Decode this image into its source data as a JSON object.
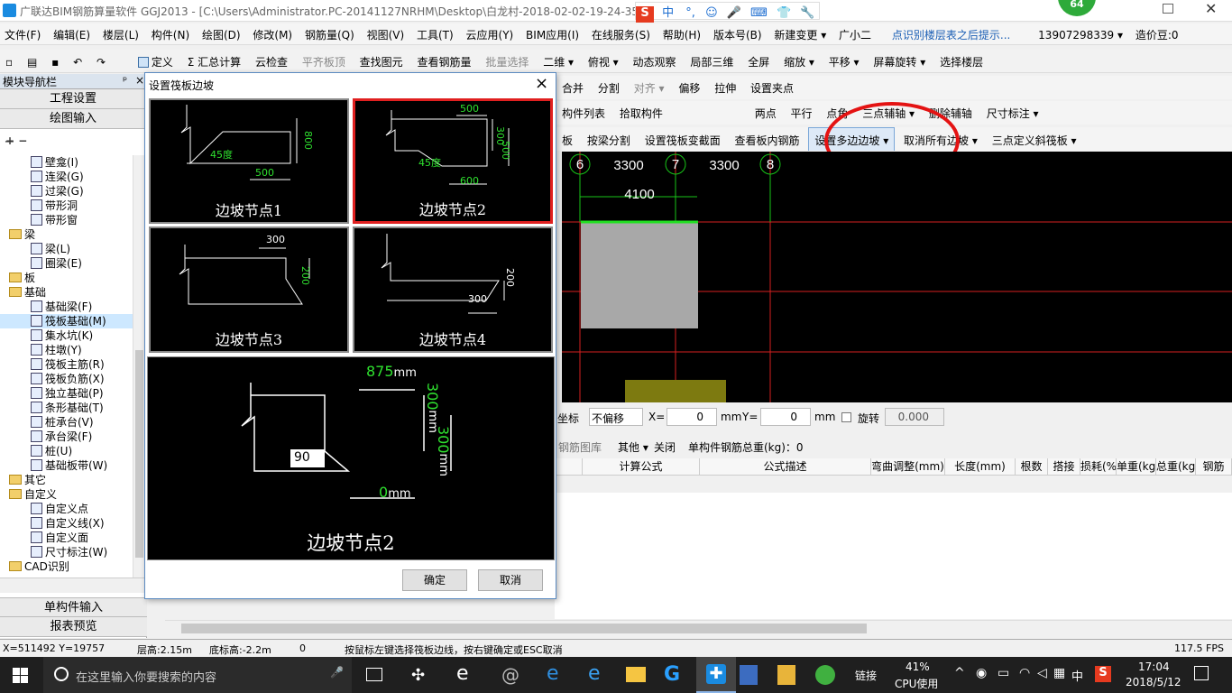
{
  "window": {
    "title": "广联达BIM钢筋算量软件 GGJ2013 - [C:\\Users\\Administrator.PC-20141127NRHM\\Desktop\\白龙村-2018-02-02-19-24-35"
  },
  "ime": {
    "items": [
      "中",
      "°,",
      "☺",
      "🎤",
      "⌨",
      "👕",
      "🛡",
      "🔧"
    ]
  },
  "badge": {
    "count": "64"
  },
  "menu": [
    "文件(F)",
    "编辑(E)",
    "楼层(L)",
    "构件(N)",
    "绘图(D)",
    "修改(M)",
    "钢筋量(Q)",
    "视图(V)",
    "工具(T)",
    "云应用(Y)",
    "BIM应用(I)",
    "在线服务(S)",
    "帮助(H)",
    "版本号(B)",
    "新建变更 ▾",
    "广小二",
    "点识别楼层表之后提示...",
    "13907298339 ▾",
    "造价豆:0"
  ],
  "toolbar1": [
    "定义",
    "Σ 汇总计算",
    "云检查",
    "平齐板顶",
    "查找图元",
    "查看钢筋量",
    "批量选择",
    "二维 ▾",
    "俯视 ▾",
    "动态观察",
    "局部三维",
    "全屏",
    "缩放 ▾",
    "平移 ▾",
    "屏幕旋转 ▾",
    "选择楼层"
  ],
  "toolbar2": [
    "合并",
    "分割",
    "对齐 ▾",
    "偏移",
    "拉伸",
    "设置夹点"
  ],
  "toolbar3": [
    "构件列表",
    "拾取构件",
    "两点",
    "平行",
    "点角",
    "三点辅轴 ▾",
    "删除辅轴",
    "尺寸标注 ▾"
  ],
  "toolbar4": [
    "板",
    "按梁分割",
    "设置筏板变截面",
    "查看板内钢筋",
    "设置多边边坡 ▾",
    "取消所有边坡 ▾",
    "三点定义斜筏板 ▾"
  ],
  "nav": {
    "header": "模块导航栏",
    "pin": "ᵖ",
    "close": "×",
    "btn1": "工程设置",
    "btn2": "绘图输入",
    "btn3": "单构件输入",
    "btn4": "报表预览"
  },
  "tree": [
    {
      "t": "壁龛(I)",
      "lvl": 2
    },
    {
      "t": "连梁(G)",
      "lvl": 2
    },
    {
      "t": "过梁(G)",
      "lvl": 2
    },
    {
      "t": "带形洞",
      "lvl": 2
    },
    {
      "t": "带形窗",
      "lvl": 2
    },
    {
      "t": "梁",
      "lvl": 1,
      "f": 1
    },
    {
      "t": "梁(L)",
      "lvl": 2
    },
    {
      "t": "圈梁(E)",
      "lvl": 2
    },
    {
      "t": "板",
      "lvl": 1,
      "f": 1
    },
    {
      "t": "基础",
      "lvl": 1,
      "f": 1
    },
    {
      "t": "基础梁(F)",
      "lvl": 2
    },
    {
      "t": "筏板基础(M)",
      "lvl": 2
    },
    {
      "t": "集水坑(K)",
      "lvl": 2
    },
    {
      "t": "柱墩(Y)",
      "lvl": 2
    },
    {
      "t": "筏板主筋(R)",
      "lvl": 2
    },
    {
      "t": "筏板负筋(X)",
      "lvl": 2
    },
    {
      "t": "独立基础(P)",
      "lvl": 2
    },
    {
      "t": "条形基础(T)",
      "lvl": 2
    },
    {
      "t": "桩承台(V)",
      "lvl": 2
    },
    {
      "t": "承台梁(F)",
      "lvl": 2
    },
    {
      "t": "桩(U)",
      "lvl": 2
    },
    {
      "t": "基础板带(W)",
      "lvl": 2
    },
    {
      "t": "其它",
      "lvl": 1,
      "f": 1
    },
    {
      "t": "自定义",
      "lvl": 1,
      "f": 1
    },
    {
      "t": "自定义点",
      "lvl": 2
    },
    {
      "t": "自定义线(X)",
      "lvl": 2
    },
    {
      "t": "自定义面",
      "lvl": 2
    },
    {
      "t": "尺寸标注(W)",
      "lvl": 2
    },
    {
      "t": "CAD识别",
      "lvl": 1,
      "f": 1
    }
  ],
  "cad": {
    "axes": [
      "6",
      "7",
      "8"
    ],
    "dims": [
      "3300",
      "3300",
      "4100"
    ]
  },
  "dialog": {
    "title": "设置筏板边坡",
    "close": "×",
    "nodes": [
      {
        "label": "边坡节点1",
        "t1": "45度",
        "t2": "500",
        "t3": "800"
      },
      {
        "label": "边坡节点2",
        "t1": "500",
        "t2": "300",
        "t3": "500",
        "t4": "45度",
        "t5": "600"
      },
      {
        "label": "边坡节点3",
        "t1": "300",
        "t2": "200"
      },
      {
        "label": "边坡节点4",
        "t1": "200",
        "t2": "300"
      }
    ],
    "preview": {
      "label": "边坡节点2",
      "top": "875",
      "top_unit": "mm",
      "right1": "300",
      "right2": "300",
      "unit_v": "mm",
      "bottom": "0",
      "bottom_unit": "mm",
      "angle": "90"
    },
    "ok": "确定",
    "cancel": "取消"
  },
  "coord": {
    "label1": "坐标",
    "offset": "不偏移",
    "x_label": "X=",
    "x": "0",
    "y_label": "Y=",
    "y": "0",
    "unit": "mm",
    "rotate": "旋转",
    "angle": "0.000"
  },
  "rebar": {
    "lib": "钢筋图库",
    "other": "其他 ▾",
    "close": "关闭",
    "total": "单构件钢筋总重(kg)：0"
  },
  "grid_cols": [
    "计算公式",
    "公式描述",
    "弯曲调整(mm)",
    "长度(mm)",
    "根数",
    "搭接",
    "损耗(%)",
    "单重(kg)",
    "总重(kg)",
    "钢筋"
  ],
  "status": {
    "xy": "X=511492 Y=19757",
    "floor": "层高:2.15m",
    "bottom": "底标高:-2.2m",
    "zero": "0",
    "hint": "按鼠标左键选择筏板边线，按右键确定或ESC取消",
    "fps": "117.5 FPS"
  },
  "taskbar": {
    "search": "在这里输入你要搜索的内容",
    "link": "链接",
    "cpu_pct": "41%",
    "cpu": "CPU使用",
    "lang": "中",
    "time": "17:04",
    "date": "2018/5/12"
  }
}
